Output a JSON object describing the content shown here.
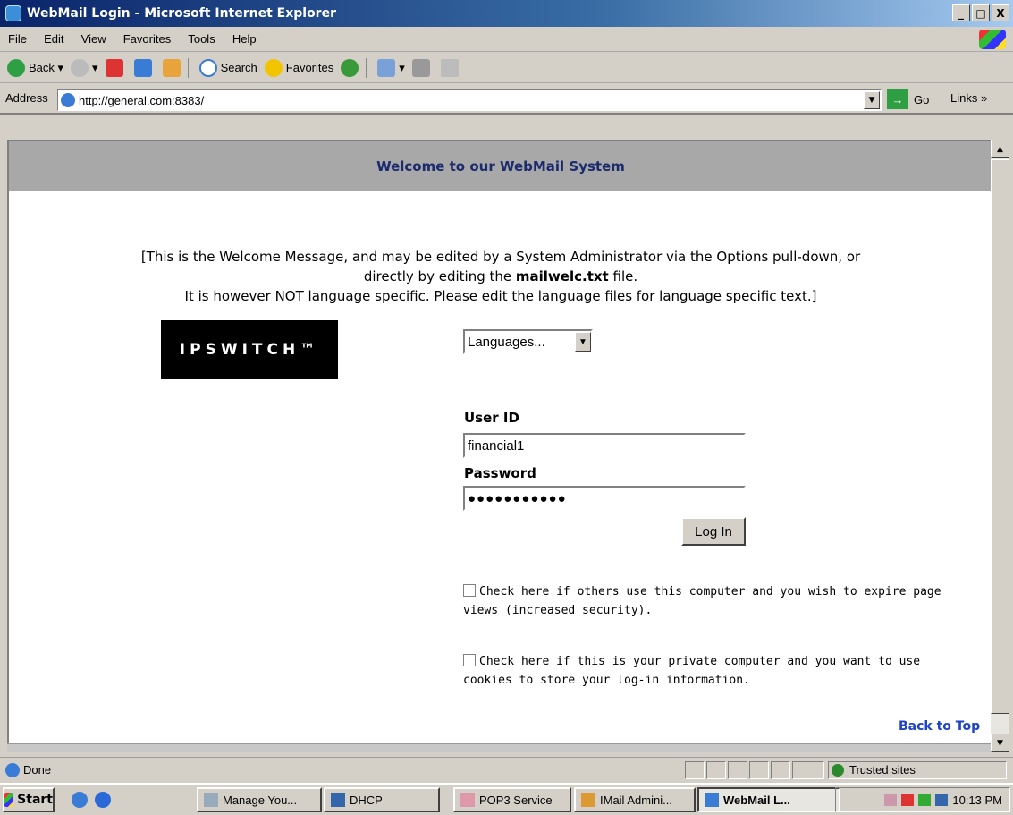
{
  "window": {
    "title": "WebMail Login - Microsoft Internet Explorer",
    "min": "_",
    "max": "□",
    "close": "X"
  },
  "menu": [
    "File",
    "Edit",
    "View",
    "Favorites",
    "Tools",
    "Help"
  ],
  "toolbar": {
    "back": "Back",
    "search": "Search",
    "favorites": "Favorites"
  },
  "address": {
    "label": "Address",
    "url": "http://general.com:8383/",
    "go": "Go",
    "links": "Links"
  },
  "page": {
    "header": "Welcome to our WebMail System",
    "welcome_line1": "[This is the Welcome Message, and may be edited by a System Administrator via the Options pull-down, or",
    "welcome_line2_pre": "directly by editing the",
    "welcome_line2_file": "mailwelc.txt",
    "welcome_line2_post": "file.",
    "welcome_line3": "It is however NOT language specific. Please edit the language files for language specific text.]",
    "logo_text": "IPSWITCH™",
    "language_select": "Languages...",
    "user_id_label": "User ID",
    "user_id_value": "financial1",
    "password_label": "Password",
    "password_value": "●●●●●●●●●●●",
    "login_button": "Log In",
    "check1_text": "Check here if others use this computer and you wish to expire page views (increased security).",
    "check2_text": "Check here if this is your private computer and you want to use cookies to store your log-in information.",
    "back_to_top": "Back to Top"
  },
  "status": {
    "text": "Done",
    "zone": "Trusted sites"
  },
  "taskbar": {
    "start": "Start",
    "tasks": [
      "Manage You...",
      "DHCP",
      "POP3 Service",
      "IMail Admini...",
      "WebMail L..."
    ],
    "clock": "10:13 PM"
  },
  "colors": {
    "header_band": "#a8a8a8",
    "header_text": "#1c2a6e",
    "link": "#1f43c6"
  }
}
